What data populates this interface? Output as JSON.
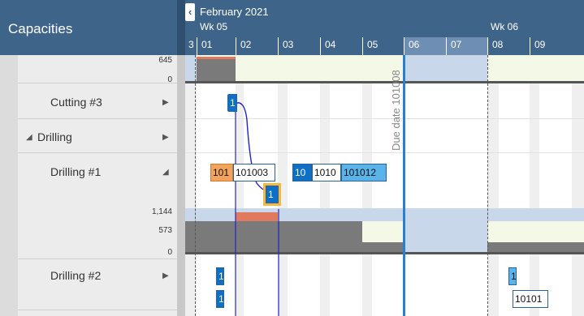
{
  "panel": {
    "title": "Capacities"
  },
  "timeline": {
    "month": "February 2021",
    "weeks": [
      "Wk 05",
      "Wk 06"
    ],
    "days": [
      "3",
      "01",
      "02",
      "03",
      "04",
      "05",
      "06",
      "07",
      "08",
      "09"
    ]
  },
  "rows": {
    "axis_top": [
      "645",
      "0"
    ],
    "cutting3": {
      "label": "Cutting #3"
    },
    "drilling": {
      "label": "Drilling"
    },
    "drilling1": {
      "label": "Drilling #1"
    },
    "axis_mid": [
      "1,144",
      "573",
      "0"
    ],
    "drilling2": {
      "label": "Drilling #2"
    }
  },
  "tasks": {
    "cut_a": "1",
    "dr1_a": "101",
    "dr1_b": "101003",
    "dr1_c": "10",
    "dr1_d": "1010",
    "dr1_e": "101012",
    "dr1_f": "1",
    "dr2_a": "1",
    "dr2_b": "1",
    "dr2_c": "1",
    "dr2_d": "10101"
  },
  "due_date": "Due date 101008",
  "colors": {
    "header": "#3e6489",
    "accent_blue": "#0e6fc7",
    "light_blue": "#5ab4ea",
    "orange": "#f2a45c",
    "highlight": "#f4b942",
    "due_line": "#2a7fd0",
    "overload": "#e07a5f"
  }
}
